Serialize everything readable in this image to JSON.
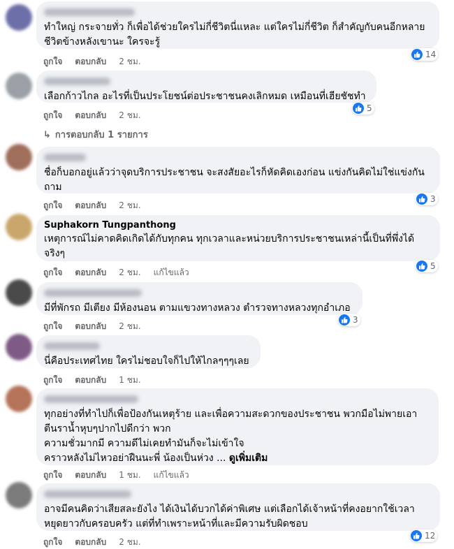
{
  "colors": {
    "bubble": "#f0f2f5",
    "meta": "#65676b",
    "reaction_blue": "#1877f2"
  },
  "icons": {
    "reaction": "like-thumb-icon",
    "replies": "reply-arrow-icon"
  },
  "comments": [
    {
      "author": "",
      "text": "ทำใหญ่ กระจายทั่ว ก็เพื่อได้ช่วยใครไม่กี่ชีวิตนี่แหละ แต่ใครไม่กี่ชีวิต ก็สำคัญกับคนอีกหลาย\nชีวิตข้างหลังเขานะ ใครจะรู้",
      "like_label": "ถูกใจ",
      "reply_label": "ตอบกลับ",
      "time": "2 ชม.",
      "edited": "",
      "reactions": "14"
    },
    {
      "author": "",
      "text": "เลือกก้าวไกล อะไรที่เป็นประโยชน์ต่อประชาชนคงเลิกหมด เหมือนที่เฮียชัชทำ",
      "like_label": "ถูกใจ",
      "reply_label": "ตอบกลับ",
      "time": "2 ชม.",
      "edited": "",
      "reactions": "5",
      "replies": "การตอบกลับ 1 รายการ"
    },
    {
      "author": "",
      "text": "ชื่อก็บอกอยู่แล้วว่าจุดบริการประชาชน จะสงสัยอะไรก็หัดคิดเองก่อน แข่งกันคิดไม่ใช่แข่งกัน\nถาม",
      "like_label": "ถูกใจ",
      "reply_label": "ตอบกลับ",
      "time": "2 ชม.",
      "edited": "",
      "reactions": "3"
    },
    {
      "author": "Suphakorn Tungpanthong",
      "text": "เหตุการณ์ไม่คาดคิดเกิดได้กับทุกคน ทุกเวลาและหน่วยบริการประชาชนเหล่านี้เป็นที่พึ่งได้\nจริงๆ",
      "like_label": "ถูกใจ",
      "reply_label": "ตอบกลับ",
      "time": "2 ชม.",
      "edited": "แก้ไขแล้ว",
      "reactions": "5"
    },
    {
      "author": "",
      "text": "มีที่พักรถ มีเตียง มีห้องนอน ตามแขวงทางหลวง ตำรวจทางหลวงทุกอำเภอ",
      "like_label": "ถูกใจ",
      "reply_label": "ตอบกลับ",
      "time": "2 ชม.",
      "edited": "",
      "reactions": "3"
    },
    {
      "author": "",
      "text": "นี่คือประเทศไทย ใครไม่ชอบใจก็ไปให้ไกลๆๆๆเลย",
      "like_label": "ถูกใจ",
      "reply_label": "ตอบกลับ",
      "time": "1 ชม.",
      "edited": ""
    },
    {
      "author": "",
      "text": "ทุกอย่างที่ทำไปก็เพื่อป้องกันเหตุร้าย และเพื่อความสะดวกของประชาชน พวกมือไม่พายเอา\nตีนราน้ำหุบๆปากไปดีกว่า พวก\nความชั่วมากมี ความดีไม่เคยทำมันก็จะไม่เข้าใจ\nคราวหลังไม่ไหวอย่าฝืนนะพี่ น้องเป็นห่วง ...",
      "see_more": "ดูเพิ่มเติม",
      "like_label": "ถูกใจ",
      "reply_label": "ตอบกลับ",
      "time": "1 ชม.",
      "edited": "แก้ไขแล้ว"
    },
    {
      "author": "",
      "text": "อาจมีคนคิดว่าเสียสละยังไง ได้เงินได้บวกได้ค่าพิเศษ แต่เลือกได้เจ้าหน้าที่คงอยากใช้เวลา\nหยุดยาวกับครอบครัว แต่ที่ทำเพราะหน้าที่และมีความรับผิดชอบ",
      "like_label": "ถูกใจ",
      "reply_label": "ตอบกลับ",
      "time": "2 ชม.",
      "edited": "",
      "reactions": "12"
    }
  ]
}
